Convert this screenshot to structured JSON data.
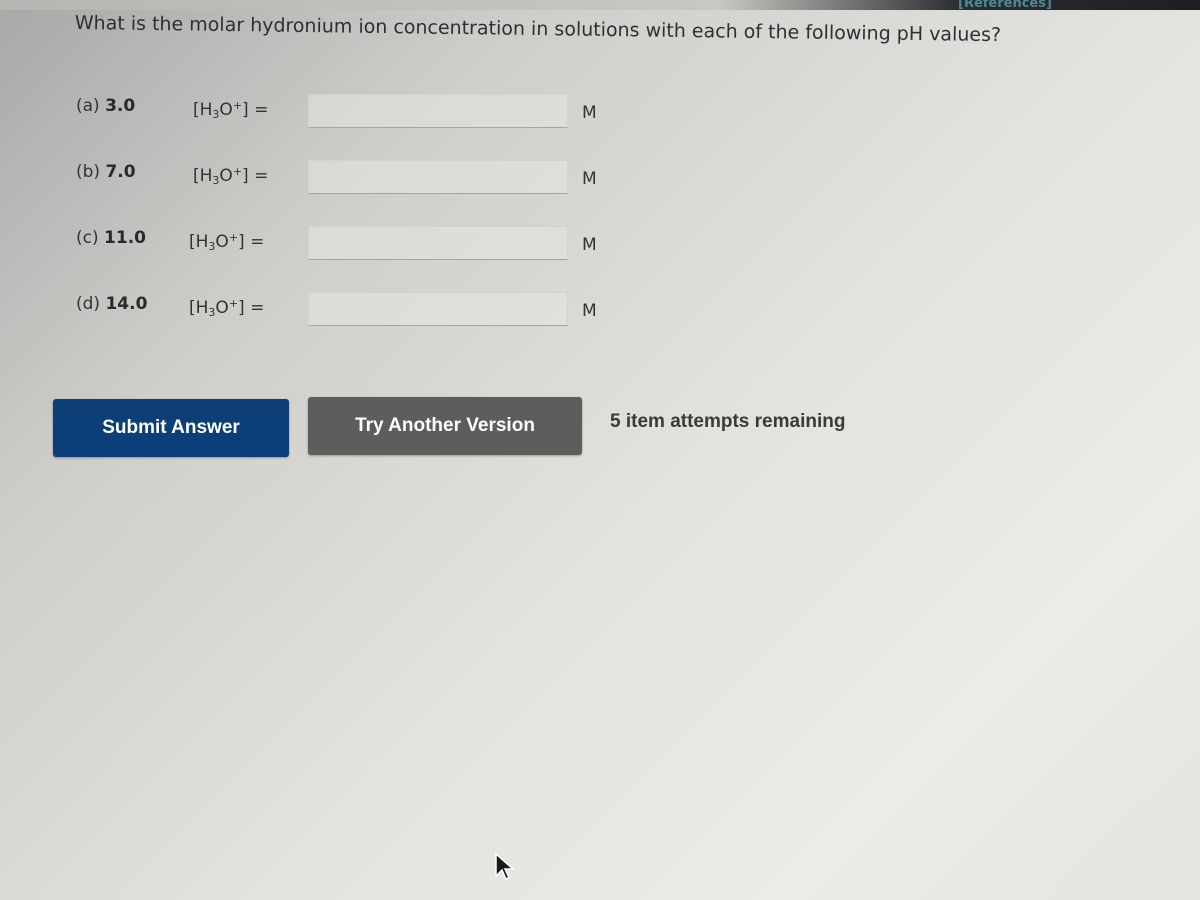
{
  "header": {
    "references_link": "[References]"
  },
  "question": {
    "text": "What is the molar hydronium ion concentration in solutions with each of the following pH values?"
  },
  "parts": [
    {
      "label": "(a)",
      "ph": "3.0",
      "formula_prefix": "[H",
      "formula_sub": "3",
      "formula_mid": "O",
      "formula_sup": "+",
      "formula_suffix": "] =",
      "value": "",
      "unit": "M"
    },
    {
      "label": "(b)",
      "ph": "7.0",
      "formula_prefix": "[H",
      "formula_sub": "3",
      "formula_mid": "O",
      "formula_sup": "+",
      "formula_suffix": "] =",
      "value": "",
      "unit": "M"
    },
    {
      "label": "(c)",
      "ph": "11.0",
      "formula_prefix": "[H",
      "formula_sub": "3",
      "formula_mid": "O",
      "formula_sup": "+",
      "formula_suffix": "] =",
      "value": "",
      "unit": "M"
    },
    {
      "label": "(d)",
      "ph": "14.0",
      "formula_prefix": "[H",
      "formula_sub": "3",
      "formula_mid": "O",
      "formula_sup": "+",
      "formula_suffix": "] =",
      "value": "",
      "unit": "M"
    }
  ],
  "actions": {
    "submit_label": "Submit Answer",
    "try_another_label": "Try Another Version",
    "attempts_text": "5 item attempts remaining"
  },
  "colors": {
    "submit_bg": "#0c3f78",
    "try_bg": "#5e5d5c",
    "references": "#4b8a8f"
  },
  "icons": {
    "cursor": "mouse-pointer-arrow"
  }
}
